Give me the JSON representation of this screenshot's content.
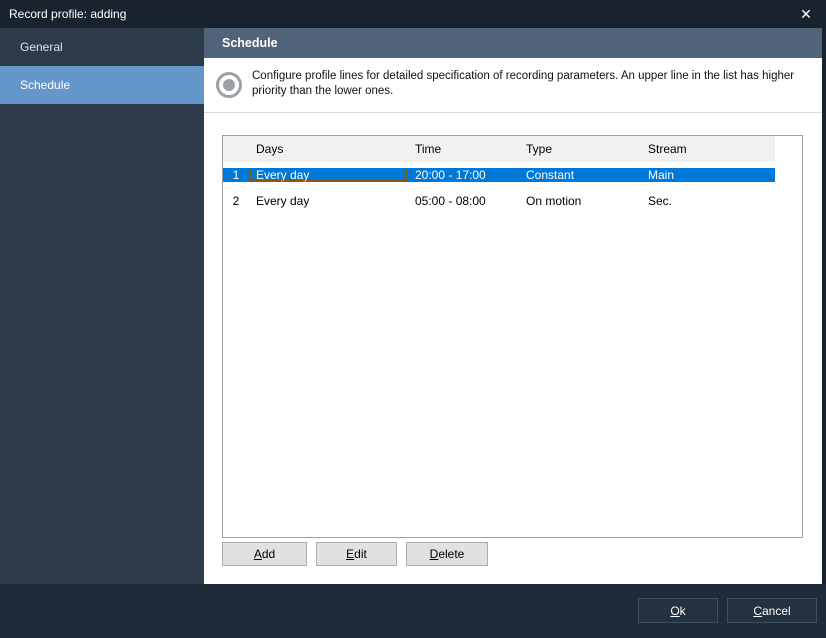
{
  "window": {
    "title": "Record profile: adding",
    "close_glyph": "✕"
  },
  "sidebar": {
    "items": [
      {
        "label": "General",
        "selected": false
      },
      {
        "label": "Schedule",
        "selected": true
      }
    ]
  },
  "content": {
    "header": "Schedule",
    "description": "Configure profile lines for detailed specification of recording parameters. An upper line in the list has higher priority than the lower ones.",
    "icon": "record-circle-icon"
  },
  "table": {
    "columns": [
      "Days",
      "Time",
      "Type",
      "Stream"
    ],
    "rows": [
      {
        "num": "1",
        "days": "Every day",
        "time": "20:00 - 17:00",
        "type": "Constant",
        "stream": "Main",
        "selected": true
      },
      {
        "num": "2",
        "days": "Every day",
        "time": "05:00 - 08:00",
        "type": "On motion",
        "stream": "Sec.",
        "selected": false
      }
    ]
  },
  "actions": {
    "add": "Add",
    "edit": "Edit",
    "delete": "Delete"
  },
  "footer": {
    "ok": "Ok",
    "cancel": "Cancel"
  },
  "colors": {
    "titlebar_bg": "#19232e",
    "sidebar_bg": "#2d3a49",
    "sidebar_selected_bg": "#6496c9",
    "header_bg": "#51647a",
    "divider": "#d8d8d8",
    "icon_gray": "#9aa1a8",
    "table_border": "#a0a0a0",
    "table_header_bg": "#f1f1f0",
    "row_selected_bg": "#0078d7",
    "focus_dotted": "#8a5200",
    "btn_bg": "#e1e1e1",
    "btn_border": "#adadad",
    "bottombar_bg": "#1f2b38",
    "dark_btn_bg": "#243140",
    "dark_btn_border": "#3d4e60"
  }
}
